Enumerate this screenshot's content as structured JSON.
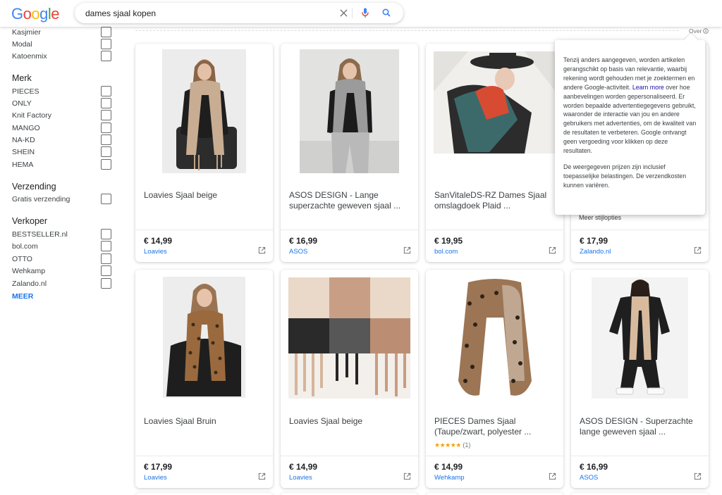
{
  "header": {
    "logo": [
      "G",
      "o",
      "o",
      "g",
      "l",
      "e"
    ],
    "logo_colors": [
      "#4285F4",
      "#EA4335",
      "#FBBC05",
      "#4285F4",
      "#34A853",
      "#EA4335"
    ],
    "search_query": "dames sjaal kopen",
    "icons": [
      "close-icon",
      "mic-icon",
      "search-icon"
    ]
  },
  "sidebar": {
    "material_items": [
      "Kasjmier",
      "Modal",
      "Katoenmix"
    ],
    "merk": {
      "title": "Merk",
      "items": [
        "PIECES",
        "ONLY",
        "Knit Factory",
        "MANGO",
        "NA-KD",
        "SHEIN",
        "HEMA"
      ]
    },
    "verzending": {
      "title": "Verzending",
      "items": [
        "Gratis verzending"
      ]
    },
    "verkoper": {
      "title": "Verkoper",
      "items": [
        "BESTSELLER.nl",
        "bol.com",
        "OTTO",
        "Wehkamp",
        "Zalando.nl"
      ]
    },
    "more_label": "MEER"
  },
  "over_label": "Over",
  "tooltip": {
    "p1_before_link": "Tenzij anders aangegeven, worden artikelen gerangschikt op basis van relevantie, waarbij rekening wordt gehouden met je zoektermen en andere Google-activiteit.",
    "link": "Learn more",
    "p1_after_link": "over hoe aanbevelingen worden gepersonaliseerd. Er worden bepaalde advertentiegegevens gebruikt, waaronder de interactie van jou en andere gebruikers met advertenties, om de kwaliteit van de resultaten te verbeteren. Google ontvangt geen vergoeding voor klikken op deze resultaten.",
    "p2": "De weergegeven prijzen zijn inclusief toepasselijke belastingen. De verzendkosten kunnen variëren."
  },
  "hidden_card_note": "Meer stijlopties",
  "products": [
    {
      "title": "Loavies Sjaal beige",
      "price": "€ 14,99",
      "seller": "Loavies",
      "image": "model-beige-scarf"
    },
    {
      "title": "ASOS DESIGN - Lange superzachte geweven sjaal ...",
      "price": "€ 16,99",
      "seller": "ASOS",
      "image": "model-grey-scarf"
    },
    {
      "title": "SanVitaleDS-RZ Dames Sjaal omslagdoek Plaid ...",
      "price": "€ 19,95",
      "seller": "bol.com",
      "image": "model-red-green-scarf"
    },
    {
      "title": "",
      "price": "€ 17,99",
      "seller": "Zalando.nl",
      "image": ""
    },
    {
      "title": "Loavies Sjaal Bruin",
      "price": "€ 17,99",
      "seller": "Loavies",
      "image": "model-leopard-scarf"
    },
    {
      "title": "Loavies Sjaal beige",
      "price": "€ 14,99",
      "seller": "Loavies",
      "image": "checked-scarf-closeup"
    },
    {
      "title": "PIECES Dames Sjaal (Taupe/zwart, polyester ...",
      "price": "€ 14,99",
      "seller": "Wehkamp",
      "image": "leopard-scarf-flat",
      "stars": "★★★★★",
      "rating_count": "(1)"
    },
    {
      "title": "ASOS DESIGN - Superzachte lange geweven sjaal ...",
      "price": "€ 16,99",
      "seller": "ASOS",
      "image": "model-long-scarf"
    }
  ]
}
